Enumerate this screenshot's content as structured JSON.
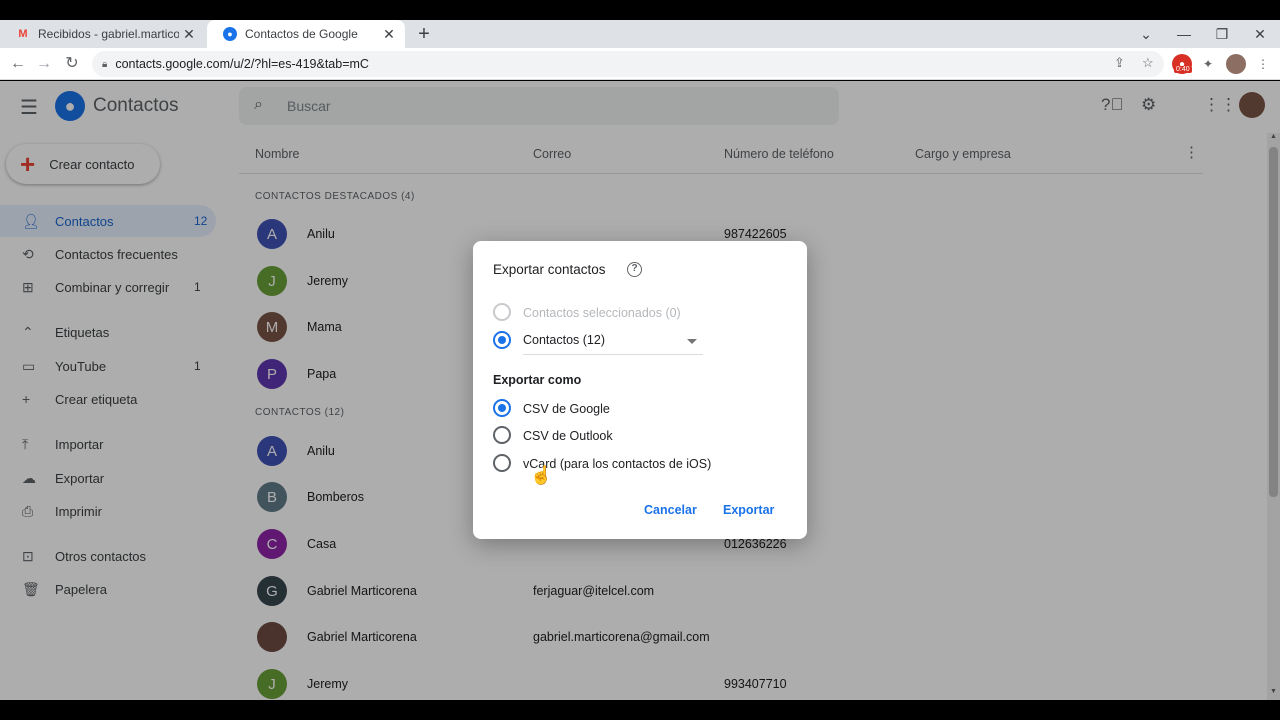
{
  "browser": {
    "tabs": [
      {
        "title": "Recibidos - gabriel.marticorena@",
        "active": false
      },
      {
        "title": "Contactos de Google",
        "active": true
      }
    ],
    "new_tab": "+",
    "url": "contacts.google.com/u/2/?hl=es-419&tab=mC",
    "extension_badge": "0:40"
  },
  "app": {
    "name": "Contactos",
    "search": {
      "placeholder": "Buscar"
    },
    "create_label": "Crear contacto",
    "nav": [
      {
        "label": "Contactos",
        "count": "12",
        "icon": "person-icon",
        "active": true
      },
      {
        "label": "Contactos frecuentes",
        "count": "",
        "icon": "history-icon"
      },
      {
        "label": "Combinar y corregir",
        "count": "1",
        "icon": "merge-icon"
      },
      {
        "label": "Etiquetas",
        "count": "",
        "icon": "chevron-up-icon"
      },
      {
        "label": "YouTube",
        "count": "1",
        "icon": "label-icon"
      },
      {
        "label": "Crear etiqueta",
        "count": "",
        "icon": "plus-icon"
      },
      {
        "label": "Importar",
        "count": "",
        "icon": "upload-icon"
      },
      {
        "label": "Exportar",
        "count": "",
        "icon": "cloud-download-icon"
      },
      {
        "label": "Imprimir",
        "count": "",
        "icon": "print-icon"
      },
      {
        "label": "Otros contactos",
        "count": "",
        "icon": "archive-icon"
      },
      {
        "label": "Papelera",
        "count": "",
        "icon": "trash-icon"
      }
    ],
    "columns": [
      "Nombre",
      "Correo",
      "Número de teléfono",
      "Cargo y empresa"
    ],
    "sections": {
      "starred": "CONTACTOS DESTACADOS (4)",
      "all": "CONTACTOS (12)"
    },
    "starred_rows": [
      {
        "initial": "A",
        "name": "Anilu",
        "email": "",
        "phone": "987422605",
        "color": "#3f51b5"
      },
      {
        "initial": "J",
        "name": "Jeremy",
        "email": "",
        "phone": "",
        "color": "#689f38"
      },
      {
        "initial": "M",
        "name": "Mama",
        "email": "",
        "phone": "",
        "color": "#795548"
      },
      {
        "initial": "P",
        "name": "Papa",
        "email": "",
        "phone": "",
        "color": "#5e35b1"
      }
    ],
    "rows": [
      {
        "initial": "A",
        "name": "Anilu",
        "email": "",
        "phone": "",
        "color": "#3f51b5"
      },
      {
        "initial": "B",
        "name": "Bomberos",
        "email": "",
        "phone": "",
        "color": "#607d8b"
      },
      {
        "initial": "C",
        "name": "Casa",
        "email": "",
        "phone": "012636226",
        "color": "#8e24aa"
      },
      {
        "initial": "G",
        "name": "Gabriel Marticorena",
        "email": "ferjaguar@itelcel.com",
        "phone": "",
        "color": "#37474f"
      },
      {
        "initial": "",
        "name": "Gabriel Marticorena",
        "email": "gabriel.marticorena@gmail.com",
        "phone": "",
        "color": "#6d4c41"
      },
      {
        "initial": "J",
        "name": "Jeremy",
        "email": "",
        "phone": "993407710",
        "color": "#689f38"
      }
    ]
  },
  "dialog": {
    "title": "Exportar contactos",
    "option_selected": "Contactos seleccionados (0)",
    "option_contacts": "Contactos (12)",
    "export_as_label": "Exportar como",
    "formats": [
      {
        "label": "CSV de Google",
        "checked": true
      },
      {
        "label": "CSV de Outlook",
        "checked": false
      },
      {
        "label": "vCard (para los contactos de iOS)",
        "checked": false
      }
    ],
    "cancel": "Cancelar",
    "export": "Exportar"
  }
}
